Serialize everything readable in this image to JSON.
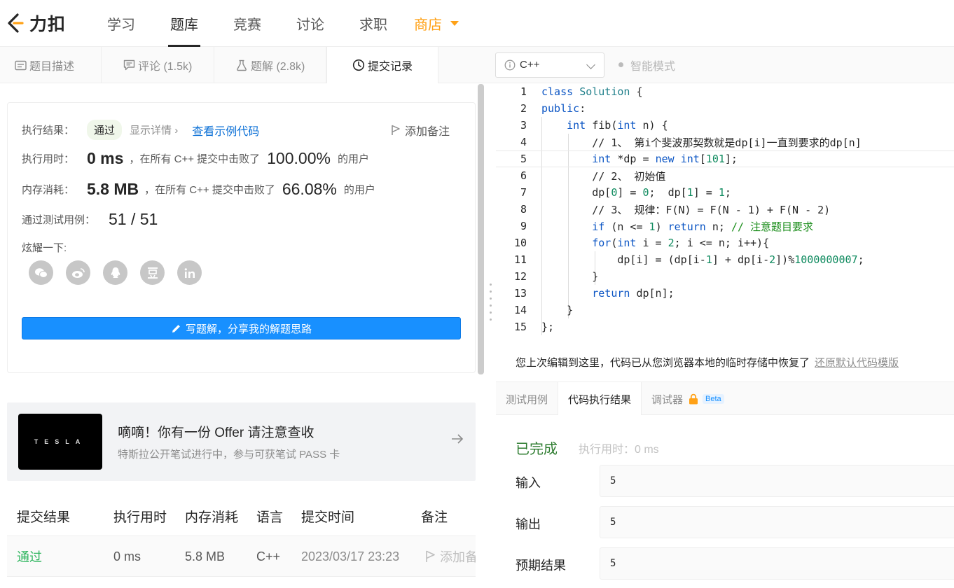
{
  "nav": {
    "logo_text": "力扣",
    "items": [
      "学习",
      "题库",
      "竞赛",
      "讨论",
      "求职"
    ],
    "shop": "商店"
  },
  "left_tabs": [
    {
      "label": "题目描述",
      "icon": "description-icon"
    },
    {
      "label": "评论 (1.5k)",
      "icon": "comment-icon"
    },
    {
      "label": "题解 (2.8k)",
      "icon": "flask-icon"
    },
    {
      "label": "提交记录",
      "icon": "clock-icon"
    }
  ],
  "toolbar": {
    "language": "C++",
    "smart_mode": "智能模式"
  },
  "result": {
    "label_result": "执行结果：",
    "status": "通过",
    "details": "显示详情",
    "example": "查看示例代码",
    "add_note": "添加备注",
    "label_time": "执行用时：",
    "time_value": "0 ms",
    "time_mid": "，在所有 C++ 提交中击败了",
    "time_pct": "100.00%",
    "time_tail": "的用户",
    "label_mem": "内存消耗：",
    "mem_value": "5.8 MB",
    "mem_mid": "，在所有 C++ 提交中击败了",
    "mem_pct": "66.08%",
    "mem_tail": "的用户",
    "label_tests": "通过测试用例：",
    "tests_value": "51 / 51",
    "share_label": "炫耀一下:",
    "write_button": "写题解，分享我的解题思路"
  },
  "ad": {
    "logo": "TESLA",
    "title": "嘀嘀！你有一份 Offer 请注意查收",
    "subtitle": "特斯拉公开笔试进行中，参与可获笔试 PASS 卡"
  },
  "table": {
    "headers": [
      "提交结果",
      "执行用时",
      "内存消耗",
      "语言",
      "提交时间",
      "备注"
    ],
    "row": [
      "通过",
      "0 ms",
      "5.8 MB",
      "C++",
      "2023/03/17 23:23",
      "添加备注"
    ]
  },
  "code_lines": [
    "class Solution {",
    "public:",
    "    int fib(int n) {",
    "        // 1、 第i个斐波那契数就是dp[i]一直到要求的dp[n]",
    "        int *dp = new int[101];",
    "        // 2、 初始值",
    "        dp[0] = 0;  dp[1] = 1;",
    "        // 3、 规律：F(N) = F(N - 1) + F(N - 2)",
    "        if (n <= 1) return n; // 注意题目要求",
    "        for(int i = 2; i <= n; i++){",
    "            dp[i] = (dp[i-1] + dp[i-2])%1000000007;",
    "        }",
    "        return dp[n];",
    "    }",
    "};"
  ],
  "restore": {
    "text": "您上次编辑到这里，代码已从您浏览器本地的临时存储中恢复了",
    "link": "还原默认代码模版"
  },
  "bottom_tabs": {
    "test_cases": "测试用例",
    "exec_result": "代码执行结果",
    "debugger": "调试器",
    "beta": "Beta"
  },
  "exec": {
    "status": "已完成",
    "time": "执行用时：0 ms",
    "input_label": "输入",
    "input_value": "5",
    "output_label": "输出",
    "output_value": "5",
    "expected_label": "预期结果",
    "expected_value": "5"
  }
}
